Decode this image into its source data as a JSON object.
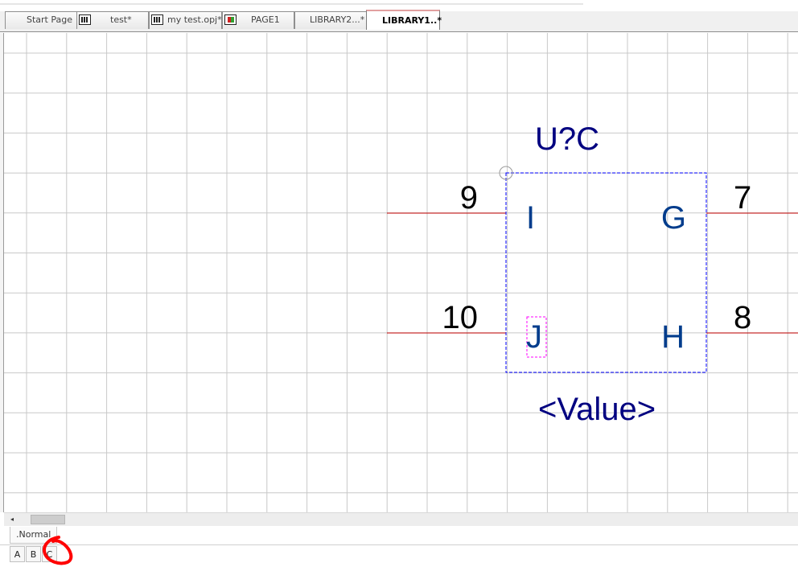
{
  "document_tabs": [
    {
      "label": "Start Page",
      "icon": "none",
      "active": false
    },
    {
      "label": "test*",
      "icon": "calc-icon",
      "active": false
    },
    {
      "label": "my test.opj*",
      "icon": "calc-icon",
      "active": false
    },
    {
      "label": "PAGE1",
      "icon": "schematic-page-icon",
      "active": false
    },
    {
      "label": "LIBRARY2...*",
      "icon": "none",
      "active": false
    },
    {
      "label": "LIBRARY1..*",
      "icon": "none",
      "active": true
    }
  ],
  "part": {
    "reference": "U?C",
    "value": "<Value>",
    "pins": [
      {
        "number": "9",
        "name": "I",
        "side": "left"
      },
      {
        "number": "10",
        "name": "J",
        "side": "left"
      },
      {
        "number": "7",
        "name": "G",
        "side": "right"
      },
      {
        "number": "8",
        "name": "H",
        "side": "right"
      }
    ]
  },
  "colors": {
    "grid": "#c8c8c8",
    "pin_line": "#c00000",
    "part_text": "#000080",
    "pin_name": "#003c8c",
    "pin_number": "#000000",
    "body_outline": "#0000ff",
    "selection": "#ff00ff",
    "annotation": "#ff0000"
  },
  "scrollbar": {
    "left_arrow": "◂"
  },
  "view_tab": {
    "label": ".Normal"
  },
  "page_tabs": [
    "A",
    "B",
    "C"
  ]
}
